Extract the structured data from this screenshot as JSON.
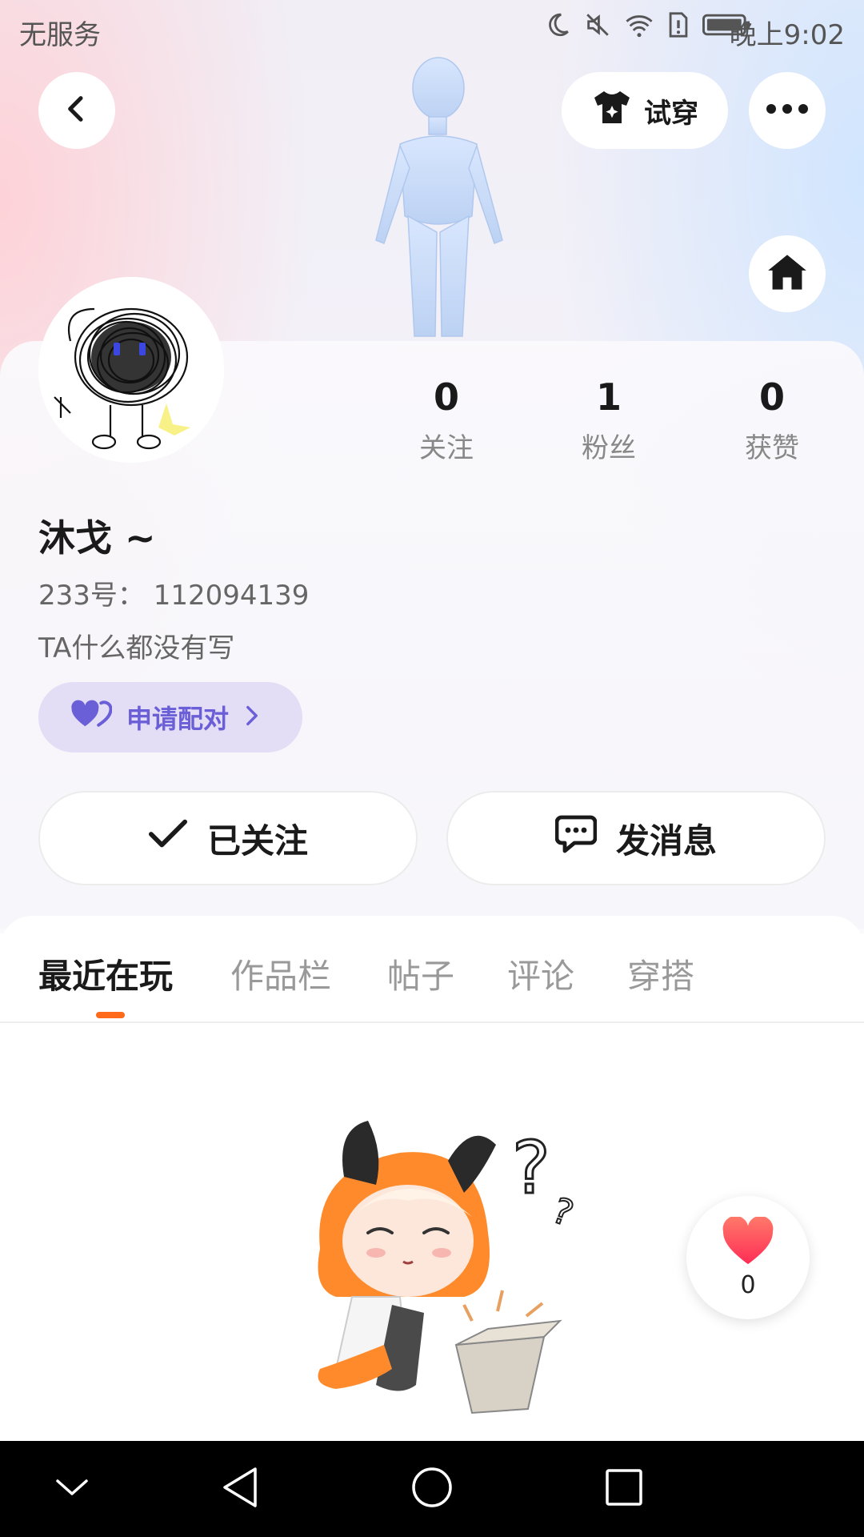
{
  "status_bar": {
    "carrier": "无服务",
    "time": "晚上9:02",
    "icons": [
      "moon-icon",
      "mute-icon",
      "wifi-icon",
      "sim-alert-icon",
      "battery-icon"
    ]
  },
  "header": {
    "back_icon": "chevron-left-icon",
    "try_on_label": "试穿",
    "try_on_icon": "shirt-icon",
    "more_icon": "more-dots-icon",
    "home_icon": "home-icon"
  },
  "profile": {
    "name": "沐戈 ~",
    "uid": "233号： 112094139",
    "bio": "TA什么都没有写",
    "pair_button": "申请配对",
    "stats": [
      {
        "value": "0",
        "label": "关注"
      },
      {
        "value": "1",
        "label": "粉丝"
      },
      {
        "value": "0",
        "label": "获赞"
      }
    ]
  },
  "actions": {
    "followed_label": "已关注",
    "message_label": "发消息"
  },
  "tabs": [
    "最近在玩",
    "作品栏",
    "帖子",
    "评论",
    "穿搭"
  ],
  "active_tab": 0,
  "like": {
    "count": "0"
  },
  "colors": {
    "accent": "#ff6a1a",
    "pair_bg": "#e3ddf6",
    "pair_text": "#6b5fd8",
    "heart": "#ff4d5a"
  }
}
